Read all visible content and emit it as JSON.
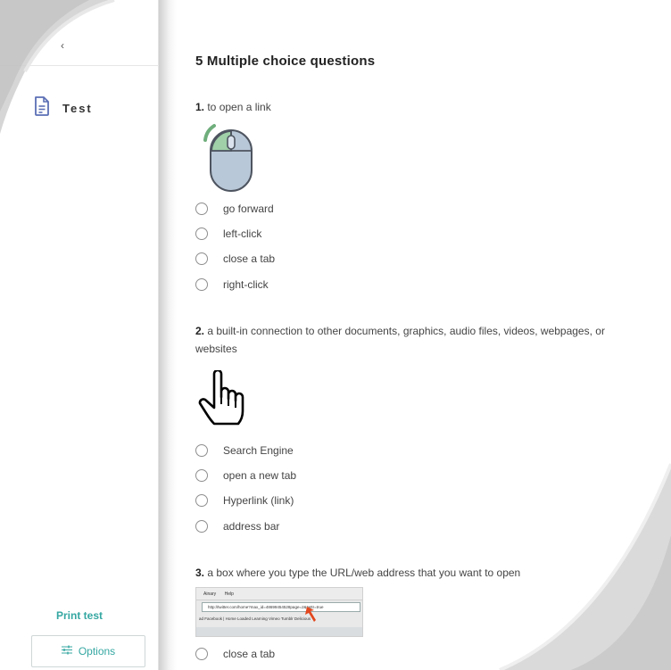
{
  "sidebar": {
    "back_glyph": "‹",
    "test_label": "Test",
    "print_label": "Print test",
    "options_label": "Options"
  },
  "quiz": {
    "title": "5 Multiple choice questions",
    "questions": [
      {
        "number": "1.",
        "text": " to open a link",
        "image": "mouse-left-click-icon",
        "options": [
          "go forward",
          "left-click",
          "close a tab",
          "right-click"
        ]
      },
      {
        "number": "2.",
        "text": " a built-in connection to other documents, graphics, audio files, videos, webpages, or websites",
        "image": "hand-pointer-icon",
        "options": [
          "Search Engine",
          "open a new tab",
          "Hyperlink (link)",
          "address bar"
        ]
      },
      {
        "number": "3.",
        "text": " a box where you type the URL/web address that you want to open",
        "image": "browser-address-bar-screenshot",
        "options": [
          "close a tab"
        ]
      }
    ]
  },
  "browser_image": {
    "menu_items": [
      "Ainary",
      "Help"
    ],
    "address": "http://twitter.com/home?max_id=48699454528page=2&twttr=true",
    "bookmarks": "ad  Facebook | Home  Loaded Learning  Vimeo  Tumblr  Delicious"
  },
  "colors": {
    "accent": "#35a7a2",
    "icon_blue": "#5b6fb5",
    "mouse_green": "#7fbf8f",
    "mouse_body": "#b9c8d8",
    "arrow_red": "#e2471d"
  }
}
